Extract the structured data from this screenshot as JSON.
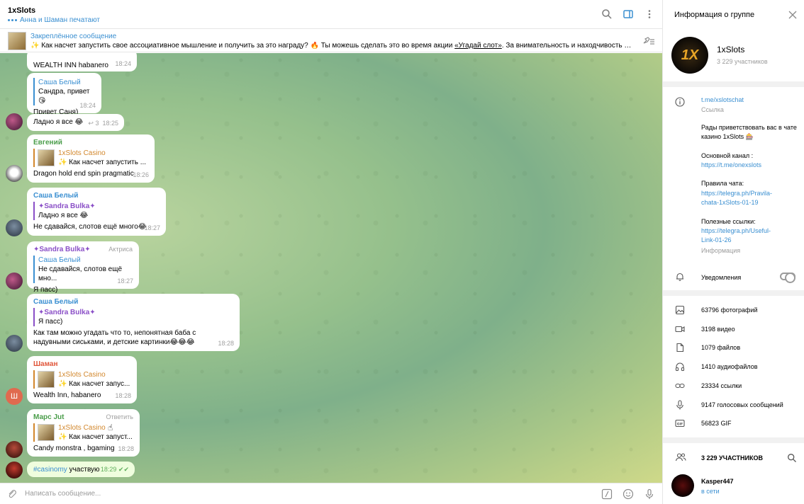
{
  "chat": {
    "title": "1xSlots",
    "typing": "Анна и Шаман печатают",
    "pinned_title": "Закреплённое сообщение",
    "pinned_text_1": "✨ Как насчет запустить свое ассоциативное мышление и получить за это награду? 🔥 Ты можешь сделать это во время акции ",
    "pinned_link": "«Угадай слот»",
    "pinned_text_2": ". За внимательность и находчивость мы разд...",
    "composer_placeholder": "Написать сообщение..."
  },
  "messages": [
    {
      "text": "WEALTH INN habanero",
      "time": "18:24"
    },
    {
      "sender": "Саша Белый",
      "quote_name": "Саша Белый",
      "quote_text": "Сандра, привет😘",
      "text": "Привет Саня)",
      "time": "18:24"
    },
    {
      "text": "Ладно я все 😂",
      "replies": "3",
      "time": "18:25"
    },
    {
      "sender": "Евгений",
      "fwd_name": "1xSlots Casino",
      "fwd_text": "✨ Как насчет запустить ...",
      "text": "Dragon hold end spin pragmatic",
      "time": "18:26"
    },
    {
      "sender": "Саша Белый",
      "quote_name": "✦Sandra Bulka✦",
      "quote_text": "Ладно я все 😂",
      "text": "Не сдавайся, слотов ещё много😂",
      "time": "18:27"
    },
    {
      "sender": "✦Sandra Bulka✦",
      "role": "Актриса",
      "quote_name": "Саша Белый",
      "quote_text": "Не сдавайся, слотов ещё мно...",
      "text": "Я пасс)",
      "time": "18:27"
    },
    {
      "sender": "Саша Белый",
      "quote_name": "✦Sandra Bulka✦",
      "quote_text": "Я пасс)",
      "text": "Как там можно угадать что то, непонятная баба с надувными сиськами, и детские картинки😂😂😂",
      "time": "18:28"
    },
    {
      "sender": "Шаман",
      "avatar_letter": "Ш",
      "fwd_name": "1xSlots Casino",
      "fwd_text": "✨ Как насчет запус...",
      "text": "Wealth Inn, habanero",
      "time": "18:28"
    },
    {
      "sender": "Марс Jut",
      "role": "Ответить",
      "fwd_name": "1xSlots Casino",
      "fwd_text": "✨ Как насчет запуст...",
      "text": "Candy   monstra , bgaming",
      "time": "18:28"
    },
    {
      "hashtag": "#casinomy",
      "text": " участвую",
      "time": "18:29"
    }
  ],
  "panel": {
    "title": "Информация о группе",
    "group_name": "1xSlots",
    "logo_text": "1X",
    "members": "3 229 участников",
    "link": "t.me/xslotschat",
    "link_label": "Ссылка",
    "desc_1": "Рады приветствовать вас в чате казино 1xSlots 🎰",
    "desc_2": "Основной канал :",
    "desc_2_link": "https://t.me/onexslots",
    "desc_3": "Правила чата:",
    "desc_3_link": "https://telegra.ph/Pravila-chata-1xSlots-01-19",
    "desc_4": "Полезные ссылки:",
    "desc_4_link": "https://telegra.ph/Useful-Link-01-26",
    "desc_label": "Информация",
    "notifications": "Уведомления",
    "media": [
      {
        "icon": "photo-icon",
        "label": "63796 фотографий"
      },
      {
        "icon": "video-icon",
        "label": "3198 видео"
      },
      {
        "icon": "file-icon",
        "label": "1079 файлов"
      },
      {
        "icon": "headphones-icon",
        "label": "1410 аудиофайлов"
      },
      {
        "icon": "link-icon",
        "label": "23334 ссылки"
      },
      {
        "icon": "microphone-icon",
        "label": "9147 голосовых сообщений"
      },
      {
        "icon": "gif-icon",
        "label": "56823 GIF"
      }
    ],
    "members_header": "3 229 УЧАСТНИКОВ",
    "member_name": "Kasper447",
    "member_status": "в сети"
  },
  "colors": {
    "accent": "#3a8fd1",
    "forward": "#d2872c",
    "purple": "#8a4fc7"
  }
}
